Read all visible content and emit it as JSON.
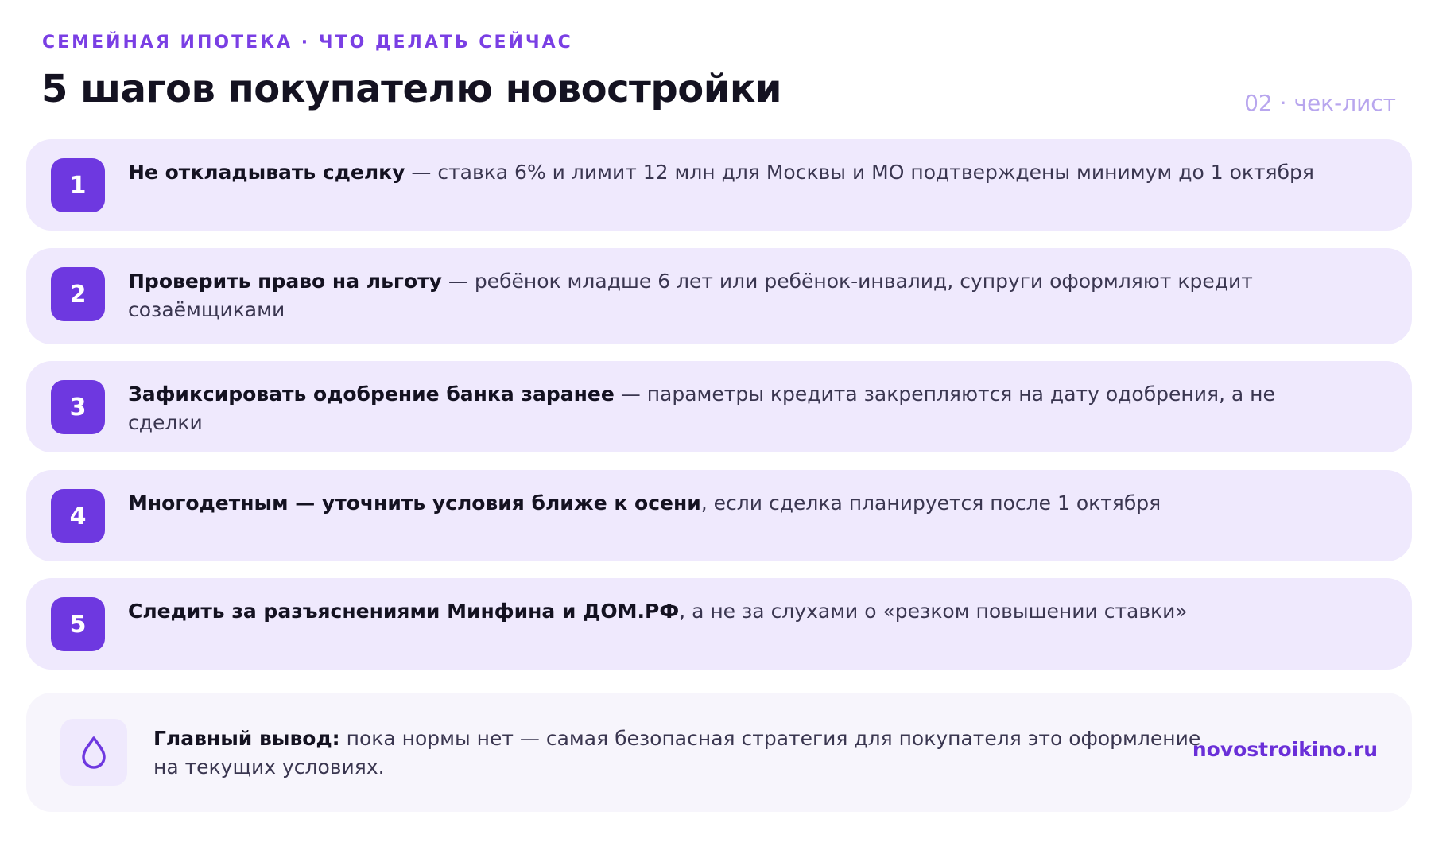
{
  "header": {
    "kicker": "СЕМЕЙНАЯ ИПОТЕКА · ЧТО ДЕЛАТЬ СЕЙЧАС",
    "title": "5 шагов покупателю новостройки",
    "page_tag": "02 · чек-лист"
  },
  "steps": [
    {
      "number": "1",
      "lead": "Не откладывать сделку",
      "rest": " — ставка 6% и лимит 12 млн для Москвы и МО подтверждены минимум до 1 октября"
    },
    {
      "number": "2",
      "lead": "Проверить право на льготу",
      "rest": " — ребёнок младше 6 лет или ребёнок-инвалид, супруги оформляют кредит созаёмщиками"
    },
    {
      "number": "3",
      "lead": "Зафиксировать одобрение банка заранее",
      "rest": " — параметры кредита закрепляются на дату одобрения, а не сделки"
    },
    {
      "number": "4",
      "lead": "Многодетным — уточнить условия ближе к осени",
      "rest": ", если сделка планируется после 1 октября"
    },
    {
      "number": "5",
      "lead": "Следить за разъяснениями Минфина и ДОМ.РФ",
      "rest": ", а не за слухами о «резком повышении ставки»"
    }
  ],
  "summary": {
    "icon": "drop-icon",
    "lead": "Главный вывод:",
    "rest": " пока нормы нет — самая безопасная стратегия для покупателя это оформление на текущих условиях.",
    "site": "novostroikino.ru"
  },
  "colors": {
    "accent": "#6e38e0",
    "card_bg": "#efe9fd",
    "summary_bg": "#f7f5fc",
    "tag": "#b8a6ee"
  }
}
